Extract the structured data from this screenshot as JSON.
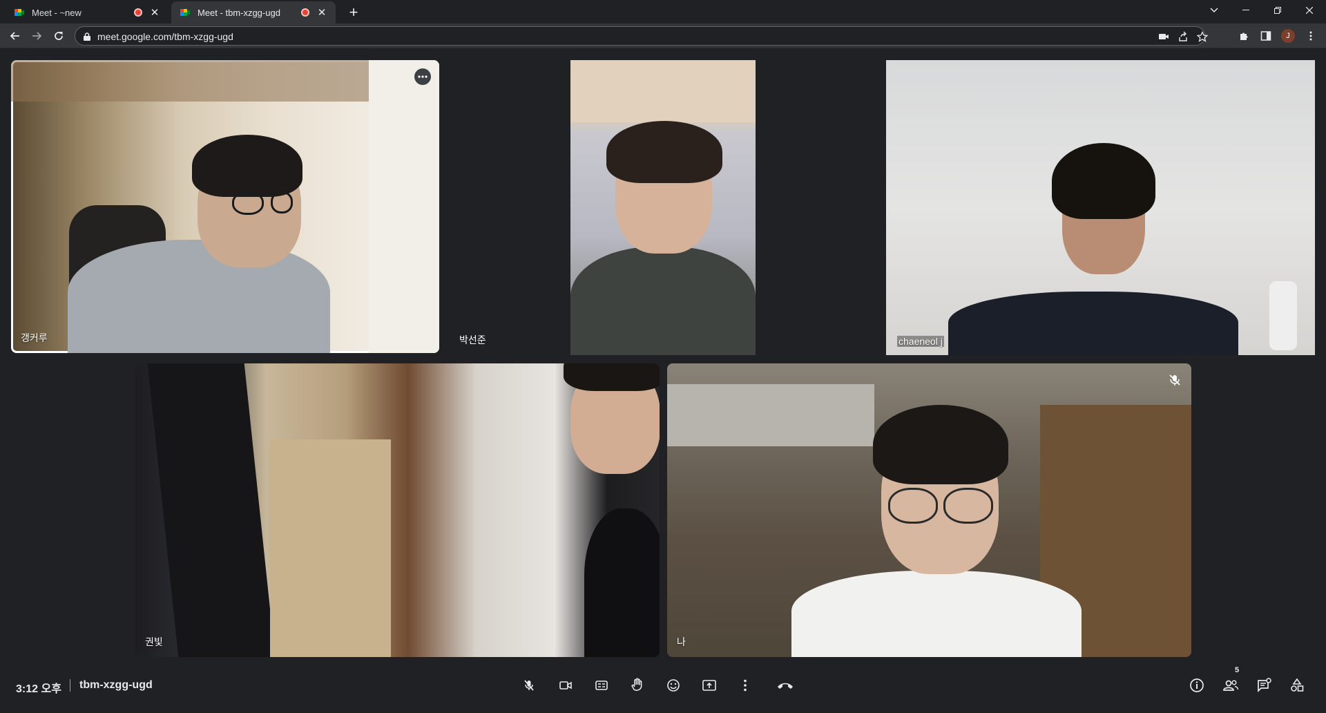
{
  "browser": {
    "tabs": [
      {
        "title": "Meet - ~new",
        "recording": true,
        "active": false
      },
      {
        "title": "Meet - tbm-xzgg-ugd",
        "recording": true,
        "active": true
      }
    ],
    "url": "meet.google.com/tbm-xzgg-ugd",
    "profile_initial": "J"
  },
  "meet": {
    "participants": [
      {
        "name": "갱커루",
        "speaking": true
      },
      {
        "name": "박선준"
      },
      {
        "name": "chaeneol j"
      },
      {
        "name": "권빛"
      },
      {
        "name": "나",
        "muted": true
      }
    ],
    "time": "3:12 오후",
    "meeting_code": "tbm-xzgg-ugd",
    "people_count": "5"
  },
  "colors": {
    "bg": "#202124",
    "end_call": "#ea4335",
    "accent": "#8ab4f8"
  }
}
